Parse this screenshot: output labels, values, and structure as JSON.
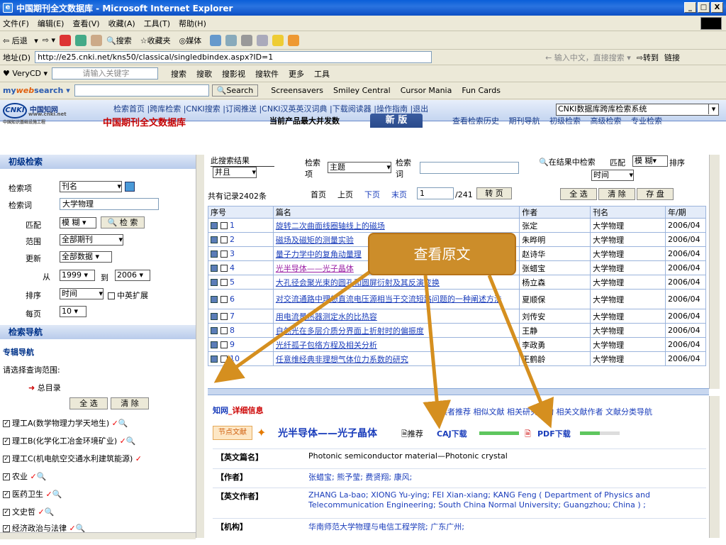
{
  "window": {
    "title": "中国期刊全文数据库 - Microsoft Internet Explorer",
    "min": "_",
    "max": "□",
    "close": "X"
  },
  "menu": [
    "文件(F)",
    "编辑(E)",
    "查看(V)",
    "收藏(A)",
    "工具(T)",
    "帮助(H)"
  ],
  "toolbar": {
    "back": "后退",
    "search": "搜索",
    "favorites": "收藏夹",
    "media": "媒体"
  },
  "address": {
    "label": "地址(D)",
    "url": "http://e25.cnki.net/kns50/classical/singledbindex.aspx?ID=1",
    "hint": "输入中文，直接搜索",
    "go": "转到",
    "links": "链接"
  },
  "verycd": {
    "brand": "VeryCD",
    "placeholder": "请输入关键字",
    "items": [
      "搜索",
      "搜歌",
      "搜影视",
      "搜软件",
      "更多",
      "工具"
    ]
  },
  "mysearch": {
    "brand_my": "my",
    "brand_web": "web",
    "brand_search": "search",
    "search_btn": "Search",
    "links": [
      "Screensavers",
      "Smiley Central",
      "Cursor Mania",
      "Fun Cards"
    ]
  },
  "banner": {
    "logo_text": "CNKI",
    "logo_cn": "中国知网",
    "logo_url": "www.cnki.net",
    "logo_sub": "中国知识基础设施工程",
    "db_title": "中国期刊全文数据库",
    "nav": "检索首页 |跨库检索 |CNKI搜索 |订阅推送 |CNKI汉英英汉词典 |下载阅读器 |操作指南 |退出",
    "promo": "当前产品最大并发数",
    "new_tab": "新 版",
    "sublinks": [
      "查看检索历史",
      "期刊导航",
      "初级检索",
      "高级检索",
      "专业检索"
    ],
    "db_select": "CNKI数据库跨库检索系统"
  },
  "left": {
    "basic_head": "初级检索",
    "field_label": "检索项",
    "field_value": "刊名",
    "word_label": "检索词",
    "word_value": "大学物理",
    "match_label": "匹配",
    "match_value": "模 糊",
    "search_btn": "检 索",
    "range_label": "范围",
    "range_value": "全部期刊",
    "update_label": "更新",
    "update_value": "全部数据",
    "from_label": "从",
    "from_value": "1999",
    "to_label": "到",
    "to_value": "2006",
    "sort_label": "排序",
    "sort_value": "时间",
    "expand_label": "中英扩展",
    "perpage_label": "每页",
    "perpage_value": "10",
    "nav_head": "检索导航",
    "special_nav": "专辑导航",
    "choose_range": "请选择查询范围:",
    "catalog": "总目录",
    "select_all": "全 选",
    "clear": "清 除",
    "categories": [
      "理工A(数学物理力学天地生)",
      "理工B(化学化工冶金环境矿业)",
      "理工C(机电航空交通水利建筑能源)",
      "农业",
      "医药卫生",
      "文史哲",
      "经济政治与法律"
    ]
  },
  "results": {
    "within_head": "此搜索结果",
    "and_value": "并且",
    "field_label": "检索项",
    "field_value": "主题",
    "word_label": "检索词",
    "search_within": "在结果中检索",
    "match_label": "匹配",
    "match_value": "模 糊",
    "sort_label": "排序",
    "sort_value": "时间",
    "total": "共有记录2402条",
    "pager": {
      "first": "首页",
      "prev": "上页",
      "next": "下页",
      "last": "末页",
      "page": "1",
      "of": "/241",
      "goto": "转 页"
    },
    "select_all": "全 选",
    "clear": "清 除",
    "save": "存 盘",
    "columns": [
      "序号",
      "篇名",
      "作者",
      "刊名",
      "年/期"
    ],
    "rows": [
      {
        "no": "1",
        "title": "旋转二次曲面线圈轴线上的磁场",
        "author": "张定",
        "journal": "大学物理",
        "issue": "2006/04"
      },
      {
        "no": "2",
        "title": "磁场及磁矩的测量实验",
        "author": "朱晔明",
        "journal": "大学物理",
        "issue": "2006/04"
      },
      {
        "no": "3",
        "title": "量子力学中的复角动量理",
        "author": "赵诗华",
        "journal": "大学物理",
        "issue": "2006/04"
      },
      {
        "no": "4",
        "title": "光半导体——光子晶体",
        "author": "张蜡宝",
        "journal": "大学物理",
        "issue": "2006/04"
      },
      {
        "no": "5",
        "title": "大孔径会聚光束的圆孔和圆屏衍射及其反演变换",
        "author": "杨立森",
        "journal": "大学物理",
        "issue": "2006/04"
      },
      {
        "no": "6",
        "title": "对交流通路中理想直流电压源相当于交流短路问题的一种阐述方法",
        "author": "夏顺保",
        "journal": "大学物理",
        "issue": "2006/04"
      },
      {
        "no": "7",
        "title": "用电流量热器测定水的比热容",
        "author": "刘传安",
        "journal": "大学物理",
        "issue": "2006/04"
      },
      {
        "no": "8",
        "title": "自然光在多层介质分界面上折射时的偏振度",
        "author": "王静",
        "journal": "大学物理",
        "issue": "2006/04"
      },
      {
        "no": "9",
        "title": "光纤孤子包络方程及相关分析",
        "author": "李政勇",
        "journal": "大学物理",
        "issue": "2006/04"
      },
      {
        "no": "10",
        "title": "任意维经典非理想气体位力系数的研究",
        "author": "王鹤龄",
        "journal": "大学物理",
        "issue": "2006/04"
      }
    ]
  },
  "detail": {
    "head": "_详细信息",
    "links": "读者推荐 相似文献 相关研究机构 相关文献作者 文献分类导航",
    "badge": "节点文献",
    "title": "光半导体——光子晶体",
    "recommend": "推荐",
    "caj": "CAJ下载",
    "pdf": "PDF下载",
    "fields": [
      {
        "label": "【英文篇名】",
        "value": "Photonic semiconductor material—Photonic crystal"
      },
      {
        "label": "【作者】",
        "value": "张蜡宝; 熊予莹; 费贤翔; 康风;"
      },
      {
        "label": "【英文作者】",
        "value": "ZHANG La-bao; XIONG Yu-ying; FEI Xian-xiang; KANG Feng ( Department of Physics and Telecommunication Engineering; South China Normal University; Guangzhou; China ) ;"
      },
      {
        "label": "【机构】",
        "value": "华南师范大学物理与电信工程学院; 广东广州;"
      }
    ]
  },
  "callout": {
    "text": "查看原文"
  }
}
